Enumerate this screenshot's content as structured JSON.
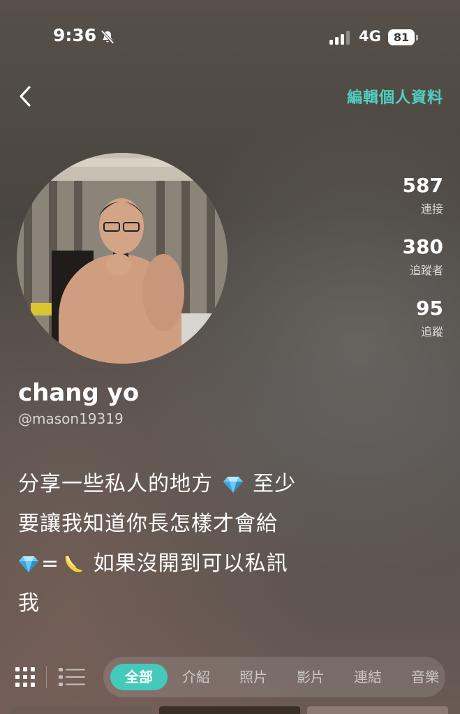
{
  "status_bar": {
    "time": "9:36",
    "network": "4G",
    "battery": "81"
  },
  "header": {
    "edit_profile_label": "編輯個人資料"
  },
  "stats": [
    {
      "value": "587",
      "label": "連接"
    },
    {
      "value": "380",
      "label": "追蹤者"
    },
    {
      "value": "95",
      "label": "追蹤"
    }
  ],
  "profile": {
    "display_name": "chang yo",
    "username": "@mason19319",
    "bio_line1_a": "分享一些私人的地方",
    "bio_line1_b": "至少",
    "bio_line2": "要讓我知道你長怎樣才會給",
    "bio_line3_eq": "=",
    "bio_line3_b": "如果沒開到可以私訊",
    "bio_line4": "我"
  },
  "tabs": [
    {
      "label": "全部",
      "active": true
    },
    {
      "label": "介紹",
      "active": false
    },
    {
      "label": "照片",
      "active": false
    },
    {
      "label": "影片",
      "active": false
    },
    {
      "label": "連結",
      "active": false
    },
    {
      "label": "音樂",
      "active": false
    }
  ],
  "colors": {
    "accent": "#45c9bb",
    "accent_text": "#4fd0c2"
  },
  "icons": [
    "bell-off-icon",
    "signal-icon",
    "battery-icon",
    "back-chevron-icon",
    "diamond-icon",
    "banana-icon",
    "grid-view-icon",
    "list-view-icon"
  ]
}
